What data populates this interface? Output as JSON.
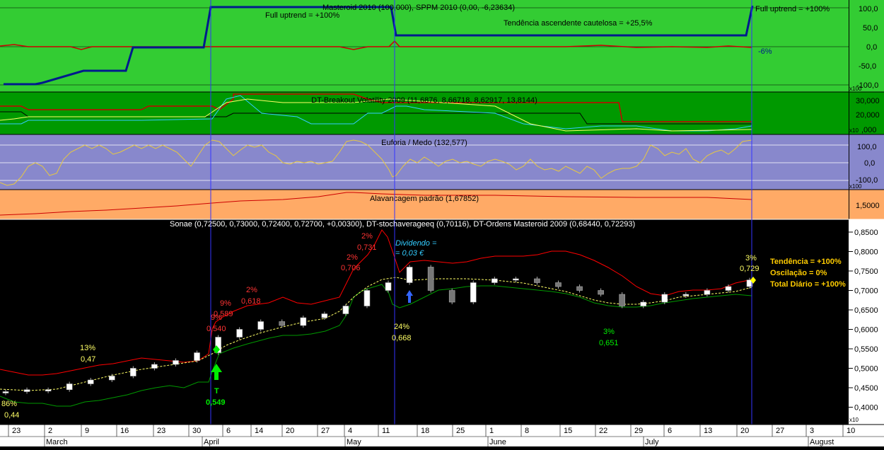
{
  "colors": {
    "panel1_bg": "#33cc33",
    "panel2_bg": "#009900",
    "panel3_bg": "#8888cc",
    "panel4_bg": "#ffaa66",
    "price_bg": "#000000",
    "axis_bg": "#ffffff",
    "dark_blue": "#001a8c",
    "red": "#ff0000",
    "yellow": "#ffff66",
    "green_line": "#00cc00",
    "cyan": "#33ccff"
  },
  "panels": {
    "masteroid": {
      "title": "Masteroid 2010 (100,000), SPPM 2010 (0,00, -6,23634)",
      "ticks": [
        "100,0",
        "50,0",
        "0,0",
        "-50,0",
        "-100,0"
      ],
      "multiplier": "x100",
      "annotations": {
        "full_uptrend_1": "Full uptrend = +100%",
        "cautious": "Tendência ascendente cautelosa = +25,5%",
        "full_uptrend_2": "Full uptrend = +100%",
        "minus6": "-6%"
      }
    },
    "breakout": {
      "title": "DT-Breakout Volatility 2009 (11,6876, 8,66718, 8,62917, 13,8144)",
      "ticks": [
        "30,000",
        "20,000",
        "10,000"
      ],
      "multiplier": "x10",
      "last_tick": ",000"
    },
    "euforia": {
      "title": "Euforia / Medo (132,577)",
      "ticks": [
        "100,0",
        "0,0",
        "-100,0"
      ],
      "multiplier": "x100"
    },
    "alavancagem": {
      "title": "Alavancagem padrão (1,67852)",
      "ticks": [
        "1,5000"
      ]
    },
    "price": {
      "title": "Sonae (0,72500, 0,73000, 0,72400, 0,72700, +0,00300), DT-stochaverageeq (0,70116), DT-Ordens Masteroid 2009 (0,68440, 0,72293)",
      "ticks": [
        "0,8500",
        "0,8000",
        "0,7500",
        "0,7000",
        "0,6500",
        "0,6000",
        "0,5500",
        "0,5000",
        "0,4500",
        "0,4000"
      ],
      "multiplier": "x10"
    }
  },
  "annotations": {
    "a86": "86%",
    "a044": "0,44",
    "a13": "13%",
    "a047": "0,47",
    "a9top": "9%",
    "a0589": "0,589",
    "a9low": "9%",
    "a0540": "0,540",
    "a2a": "2%",
    "a0618": "0,618",
    "a2b": "2%",
    "a0706": "0,706",
    "a2c": "2%",
    "a0731": "0,731",
    "dividendo1": "Dividendo =",
    "dividendo2": "= 0,03 €",
    "a24": "24%",
    "a0668": "0,668",
    "a3g": "3%",
    "a0651": "0,651",
    "a3y": "3%",
    "a0729": "0,729",
    "t_label": "T",
    "a0549": "0,549",
    "tendencia": "Tendência = +100%",
    "oscilacao": "Oscilação = 0%",
    "total": "Total Diário = +100%"
  },
  "x_axis": {
    "day_labels": [
      "23",
      "2",
      "9",
      "16",
      "23",
      "30",
      "6",
      "14",
      "20",
      "27",
      "4",
      "11",
      "18",
      "25",
      "1",
      "8",
      "15",
      "22",
      "29",
      "6",
      "13",
      "20",
      "27",
      "3",
      "10"
    ],
    "month_labels": [
      "March",
      "April",
      "May",
      "June",
      "July",
      "August"
    ]
  },
  "chart_data": [
    {
      "type": "line",
      "title": "Masteroid 2010 (100,000), SPPM 2010 (0,00, -6,23634)",
      "ylim": [
        -100,
        100
      ],
      "series": [
        {
          "name": "Masteroid 2010",
          "values": [
            -100,
            -100,
            -75,
            -75,
            0,
            0,
            0,
            100,
            100,
            100,
            100,
            100,
            25.5,
            25.5,
            25.5,
            25.5,
            25.5,
            100
          ]
        },
        {
          "name": "SPPM 2010",
          "values": [
            0,
            5,
            0,
            -5,
            0,
            0,
            0,
            0,
            0,
            -5,
            0,
            5,
            0,
            0,
            0,
            0,
            0,
            -6.2
          ]
        }
      ]
    },
    {
      "type": "line",
      "title": "DT-Breakout Volatility 2009 (11,6876, 8,66718, 8,62917, 13,8144)",
      "ylim": [
        0,
        40000
      ],
      "series": [
        {
          "name": "",
          "values": [
            25000,
            20000,
            20000,
            20000,
            30000,
            30000,
            28000,
            28000,
            28000,
            28000,
            18000,
            18000,
            15000,
            15000,
            15000
          ]
        },
        {
          "name": "",
          "values": [
            22000,
            20000,
            20000,
            22000,
            38000,
            38000,
            36000,
            36000,
            36000,
            36000,
            36000,
            36000,
            15000,
            13800,
            13800
          ]
        },
        {
          "name": "",
          "values": [
            20000,
            18000,
            18000,
            18000,
            32000,
            26000,
            16000,
            14000,
            12000,
            8000,
            8000,
            8000,
            8600,
            8600,
            8600
          ]
        },
        {
          "name": "",
          "values": [
            18000,
            18000,
            16000,
            16000,
            34000,
            30000,
            20000,
            18000,
            14000,
            10000,
            8000,
            10000,
            8000,
            8600,
            8600
          ]
        }
      ]
    },
    {
      "type": "line",
      "title": "Euforia / Medo (132,577)",
      "ylim": [
        -150,
        150
      ],
      "series": [
        {
          "name": "Euforia / Medo",
          "values": [
            -120,
            -80,
            40,
            100,
            60,
            80,
            20,
            60,
            100,
            -20,
            120,
            80,
            0,
            40,
            100,
            120,
            -60,
            20,
            40,
            0,
            20,
            60,
            20,
            -40,
            20,
            -80,
            100,
            80,
            60,
            132.6
          ]
        }
      ]
    },
    {
      "type": "line",
      "title": "Alavancagem padrão (1,67852)",
      "ylim": [
        1.3,
        1.75
      ],
      "series": [
        {
          "name": "Alavancagem padrão",
          "values": [
            1.4,
            1.45,
            1.5,
            1.55,
            1.62,
            1.65,
            1.68,
            1.66,
            1.66,
            1.65,
            1.67,
            1.68
          ]
        }
      ]
    },
    {
      "type": "line",
      "title": "Sonae (0,72500, 0,73000, 0,72400, 0,72700, +0,00300), DT-stochaverageeq (0,70116), DT-Ordens Masteroid 2009 (0,68440, 0,72293)",
      "ylim": [
        0.38,
        0.86
      ],
      "series": [
        {
          "name": "Sonae",
          "values": [
            0.44,
            0.445,
            0.445,
            0.46,
            0.47,
            0.48,
            0.5,
            0.51,
            0.52,
            0.54,
            0.58,
            0.6,
            0.62,
            0.61,
            0.63,
            0.64,
            0.66,
            0.7,
            0.72,
            0.76,
            0.7,
            0.67,
            0.72,
            0.73,
            0.73,
            0.72,
            0.71,
            0.7,
            0.69,
            0.66,
            0.67,
            0.69,
            0.69,
            0.7,
            0.71,
            0.727
          ]
        },
        {
          "name": "DT-stochaverageeq",
          "values": [
            0.43,
            0.44,
            0.45,
            0.46,
            0.47,
            0.48,
            0.49,
            0.5,
            0.52,
            0.54,
            0.57,
            0.59,
            0.6,
            0.61,
            0.62,
            0.63,
            0.65,
            0.68,
            0.7,
            0.72,
            0.71,
            0.7,
            0.71,
            0.72,
            0.72,
            0.72,
            0.71,
            0.7,
            0.69,
            0.67,
            0.66,
            0.67,
            0.68,
            0.69,
            0.7,
            0.701
          ]
        },
        {
          "name": "DT-Ordens Masteroid 2009",
          "values": [
            0.48,
            0.47,
            0.46,
            0.47,
            0.48,
            0.5,
            0.52,
            0.52,
            0.53,
            0.52,
            0.6,
            0.63,
            0.64,
            0.63,
            0.64,
            0.66,
            0.69,
            0.76,
            0.83,
            0.84,
            0.78,
            0.77,
            0.78,
            0.78,
            0.78,
            0.77,
            0.75,
            0.74,
            0.73,
            0.72,
            0.7,
            0.7,
            0.71,
            0.72,
            0.72,
            0.723
          ]
        },
        {
          "name": "",
          "values": [
            0.44,
            0.43,
            0.42,
            0.42,
            0.43,
            0.44,
            0.45,
            0.46,
            0.47,
            0.48,
            0.55,
            0.57,
            0.58,
            0.57,
            0.58,
            0.6,
            0.63,
            0.66,
            0.69,
            0.71,
            0.65,
            0.67,
            0.69,
            0.71,
            0.71,
            0.7,
            0.69,
            0.68,
            0.67,
            0.65,
            0.66,
            0.66,
            0.67,
            0.68,
            0.68,
            0.684
          ]
        }
      ]
    }
  ]
}
